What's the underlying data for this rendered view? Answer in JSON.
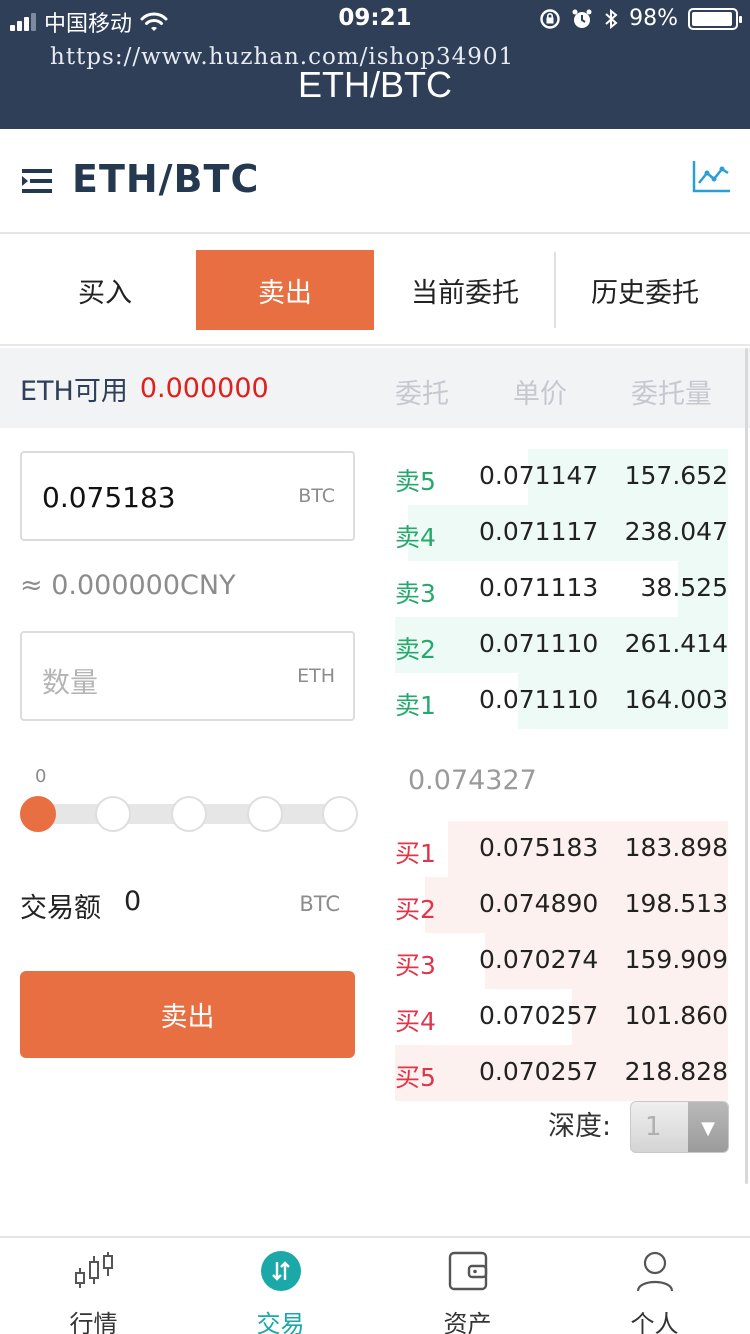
{
  "status_bar": {
    "carrier": "中国移动",
    "time": "09:21",
    "battery": "98%"
  },
  "watermark": "https://www.huzhan.com/ishop34901",
  "header": {
    "title": "ETH/BTC"
  },
  "pair": {
    "title": "ETH/BTC"
  },
  "tabs": [
    {
      "label": "买入",
      "active": false
    },
    {
      "label": "卖出",
      "active": true
    },
    {
      "label": "当前委托",
      "active": false
    },
    {
      "label": "历史委托",
      "active": false
    }
  ],
  "form": {
    "available_label": "ETH可用",
    "available_value": "0.000000",
    "price_value": "0.075183",
    "price_unit": "BTC",
    "approx_label": "≈ 0.000000CNY",
    "quantity_placeholder": "数量",
    "quantity_unit": "ETH",
    "slider_min": "0",
    "slider_level": 0,
    "amount_label": "交易额",
    "amount_value": "0",
    "amount_unit": "BTC",
    "submit_label": "卖出"
  },
  "order_book": {
    "headers": [
      "委托",
      "单价",
      "委托量"
    ],
    "asks": [
      {
        "label": "卖5",
        "price": "0.071147",
        "qty": "157.652",
        "depth": 0.6
      },
      {
        "label": "卖4",
        "price": "0.071117",
        "qty": "238.047",
        "depth": 0.96
      },
      {
        "label": "卖3",
        "price": "0.071113",
        "qty": "38.525",
        "depth": 0.15
      },
      {
        "label": "卖2",
        "price": "0.071110",
        "qty": "261.414",
        "depth": 1.0
      },
      {
        "label": "卖1",
        "price": "0.071110",
        "qty": "164.003",
        "depth": 0.63
      }
    ],
    "last_price": "0.074327",
    "bids": [
      {
        "label": "买1",
        "price": "0.075183",
        "qty": "183.898",
        "depth": 0.84
      },
      {
        "label": "买2",
        "price": "0.074890",
        "qty": "198.513",
        "depth": 0.91
      },
      {
        "label": "买3",
        "price": "0.070274",
        "qty": "159.909",
        "depth": 0.73
      },
      {
        "label": "买4",
        "price": "0.070257",
        "qty": "101.860",
        "depth": 0.47
      },
      {
        "label": "买5",
        "price": "0.070257",
        "qty": "218.828",
        "depth": 1.0
      }
    ],
    "depth_label": "深度:",
    "depth_value": "1"
  },
  "bottom_nav": [
    {
      "label": "行情",
      "icon": "candlestick-icon",
      "active": false
    },
    {
      "label": "交易",
      "icon": "swap-icon",
      "active": true
    },
    {
      "label": "资产",
      "icon": "wallet-icon",
      "active": false
    },
    {
      "label": "个人",
      "icon": "person-icon",
      "active": false
    }
  ],
  "colors": {
    "header_bg": "#2f3f57",
    "accent": "#e86f42",
    "ask": "#26a96c",
    "bid": "#e0344a",
    "nav_active": "#1aa8a9",
    "available_value": "#e0201c"
  }
}
